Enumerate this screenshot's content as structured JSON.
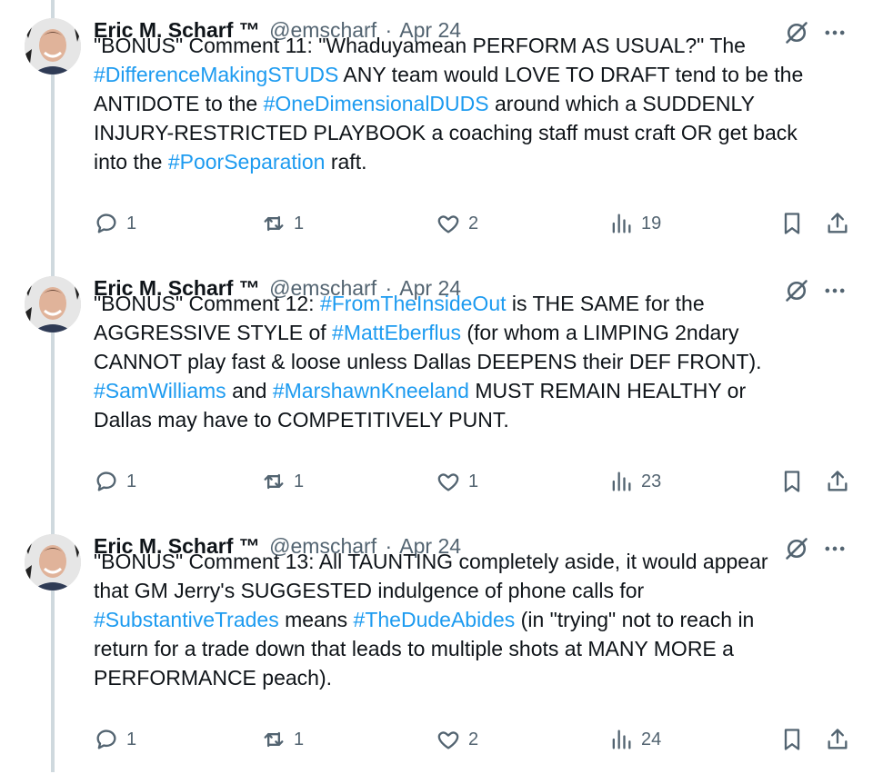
{
  "thread": {
    "tweets": [
      {
        "author": "Eric M. Scharf ™",
        "handle": "@emscharf",
        "sep": "·",
        "date": "Apr 24",
        "lines": [
          [
            {
              "t": "\"BONUS\" Comment 11: \"Whaduyamean PERFORM AS USUAL?\" The"
            }
          ],
          [
            {
              "t": "#DifferenceMakingSTUDS",
              "h": true
            },
            {
              "t": " ANY team would LOVE TO DRAFT tend to be the"
            }
          ],
          [
            {
              "t": "ANTIDOTE to the "
            },
            {
              "t": "#OneDimensionalDUDS",
              "h": true
            },
            {
              "t": " around which a SUDDENLY"
            }
          ],
          [
            {
              "t": "INJURY-RESTRICTED PLAYBOOK a coaching staff must craft OR get back"
            }
          ],
          [
            {
              "t": "into the "
            },
            {
              "t": "#PoorSeparation",
              "h": true
            },
            {
              "t": " raft."
            }
          ]
        ],
        "stats": {
          "replies": "1",
          "reposts": "1",
          "likes": "2",
          "views": "19"
        }
      },
      {
        "author": "Eric M. Scharf ™",
        "handle": "@emscharf",
        "sep": "·",
        "date": "Apr 24",
        "lines": [
          [
            {
              "t": "\"BONUS\" Comment 12: "
            },
            {
              "t": "#FromTheInsideOut",
              "h": true
            },
            {
              "t": " is THE SAME for the"
            }
          ],
          [
            {
              "t": "AGGRESSIVE STYLE of "
            },
            {
              "t": "#MattEberflus",
              "h": true
            },
            {
              "t": " (for whom a LIMPING 2ndary"
            }
          ],
          [
            {
              "t": "CANNOT play fast & loose unless Dallas DEEPENS their DEF FRONT)."
            }
          ],
          [
            {
              "t": "#SamWilliams",
              "h": true
            },
            {
              "t": " and "
            },
            {
              "t": "#MarshawnKneeland",
              "h": true
            },
            {
              "t": " MUST REMAIN HEALTHY or"
            }
          ],
          [
            {
              "t": "Dallas may have to COMPETITIVELY PUNT."
            }
          ]
        ],
        "stats": {
          "replies": "1",
          "reposts": "1",
          "likes": "1",
          "views": "23"
        }
      },
      {
        "author": "Eric M. Scharf ™",
        "handle": "@emscharf",
        "sep": "·",
        "date": "Apr 24",
        "lines": [
          [
            {
              "t": "\"BONUS\" Comment 13: All TAUNTING completely aside, it would appear"
            }
          ],
          [
            {
              "t": "that GM Jerry's SUGGESTED indulgence of phone calls for"
            }
          ],
          [
            {
              "t": "#SubstantiveTrades",
              "h": true
            },
            {
              "t": " means "
            },
            {
              "t": "#TheDudeAbides",
              "h": true
            },
            {
              "t": " (in \"trying\" not to reach in"
            }
          ],
          [
            {
              "t": "return for a trade down that leads to multiple shots at MANY MORE a"
            }
          ],
          [
            {
              "t": "PERFORMANCE peach)."
            }
          ]
        ],
        "stats": {
          "replies": "1",
          "reposts": "1",
          "likes": "2",
          "views": "24"
        }
      }
    ]
  },
  "icons": {
    "grok": "grok-icon",
    "more": "more-icon",
    "reply": "reply-icon",
    "repost": "repost-icon",
    "like": "heart-icon",
    "views": "views-icon",
    "bookmark": "bookmark-icon",
    "share": "share-icon"
  },
  "colors": {
    "text": "#0f1419",
    "muted": "#536471",
    "link": "#1d9bf0",
    "thread_line": "#cfd9de"
  }
}
